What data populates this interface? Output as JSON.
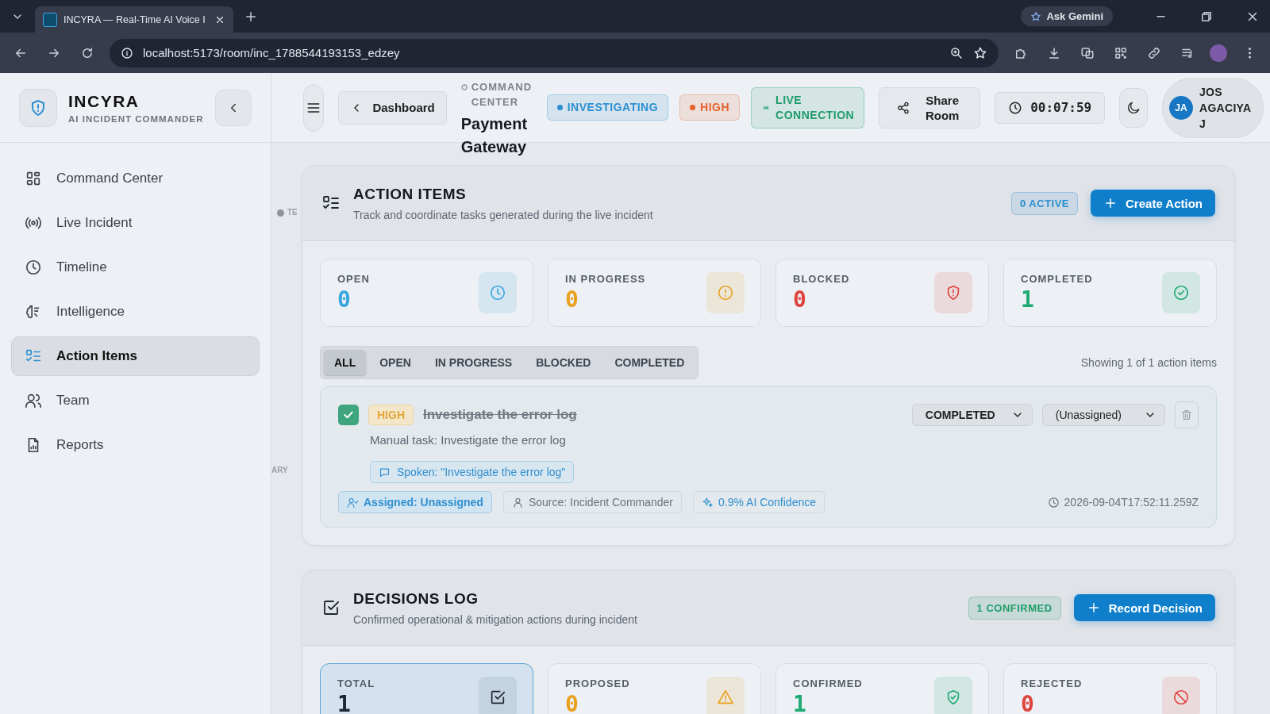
{
  "browser": {
    "tab_title": "INCYRA — Real-Time AI Voice I",
    "url": "localhost:5173/room/inc_1788544193153_edzey",
    "assistant": "Ask Gemini"
  },
  "sidebar": {
    "brand": "INCYRA",
    "tagline": "AI INCIDENT COMMANDER",
    "items": [
      {
        "label": "Command Center",
        "kind": "grid",
        "selected": false
      },
      {
        "label": "Live Incident",
        "kind": "broadcast",
        "selected": false
      },
      {
        "label": "Timeline",
        "kind": "clock",
        "selected": false
      },
      {
        "label": "Intelligence",
        "kind": "brain",
        "selected": false
      },
      {
        "label": "Action Items",
        "kind": "checklist",
        "selected": true
      },
      {
        "label": "Team",
        "kind": "people",
        "selected": false
      },
      {
        "label": "Reports",
        "kind": "report",
        "selected": false
      }
    ]
  },
  "header": {
    "back": "Dashboard",
    "eyebrow": "COMMAND CENTER",
    "title": "Payment Gateway",
    "badges": [
      {
        "label": "INVESTIGATING",
        "kind": "dot",
        "color": "#2b8fd0"
      },
      {
        "label": "HIGH",
        "kind": "dot",
        "color": "#e8622a"
      },
      {
        "label": "LIVE CONNECTION",
        "kind": "signal",
        "color": "#1f9d6b"
      }
    ],
    "share": "Share Room",
    "timer": "00:07:59",
    "user": {
      "initials": "JA",
      "name": "JOS AGACIYA J"
    }
  },
  "canvas_labels": [
    {
      "text": "TE",
      "kind": "top"
    },
    {
      "text": "ARY",
      "kind": "bottom"
    }
  ],
  "action_items": {
    "title": "ACTION ITEMS",
    "subtitle": "Track and coordinate tasks generated during the live incident",
    "badge": "0 ACTIVE",
    "button": "Create Action",
    "stats": [
      {
        "label": "OPEN",
        "value": "0",
        "kind": "clock",
        "color": "#3aa6e0",
        "selected": false
      },
      {
        "label": "IN PROGRESS",
        "value": "0",
        "kind": "alert",
        "color": "#e9a11f",
        "selected": false
      },
      {
        "label": "BLOCKED",
        "value": "0",
        "kind": "shield",
        "color": "#e0443e",
        "selected": false
      },
      {
        "label": "COMPLETED",
        "value": "1",
        "kind": "check-circle",
        "color": "#1faa74",
        "selected": false
      }
    ],
    "filters": [
      {
        "label": "ALL",
        "selected": true
      },
      {
        "label": "OPEN",
        "selected": false
      },
      {
        "label": "IN PROGRESS",
        "selected": false
      },
      {
        "label": "BLOCKED",
        "selected": false
      },
      {
        "label": "COMPLETED",
        "selected": false
      }
    ],
    "showing": "Showing 1 of 1 action items",
    "items": [
      {
        "done": true,
        "priority": "HIGH",
        "title": "Investigate the error log",
        "description": "Manual task: Investigate the error log",
        "quote": "Spoken: \"Investigate the error log\"",
        "assigned_label": "Assigned:",
        "assigned_value": "Unassigned",
        "source": "Source: Incident Commander",
        "confidence": "0.9% AI Confidence",
        "status": "COMPLETED",
        "assignee": "(Unassigned)",
        "timestamp": "2026-09-04T17:52:11.259Z"
      }
    ]
  },
  "decisions": {
    "title": "DECISIONS LOG",
    "subtitle": "Confirmed operational & mitigation actions during incident",
    "badge": "1 CONFIRMED",
    "button": "Record Decision",
    "stats": [
      {
        "label": "TOTAL",
        "value": "1",
        "kind": "check-square",
        "color": "#1e2733",
        "selected": true
      },
      {
        "label": "PROPOSED",
        "value": "0",
        "kind": "triangle",
        "color": "#e9a11f",
        "selected": false
      },
      {
        "label": "CONFIRMED",
        "value": "1",
        "kind": "shield-check",
        "color": "#1faa74",
        "selected": false
      },
      {
        "label": "REJECTED",
        "value": "0",
        "kind": "ban",
        "color": "#e0443e",
        "selected": false
      }
    ]
  }
}
